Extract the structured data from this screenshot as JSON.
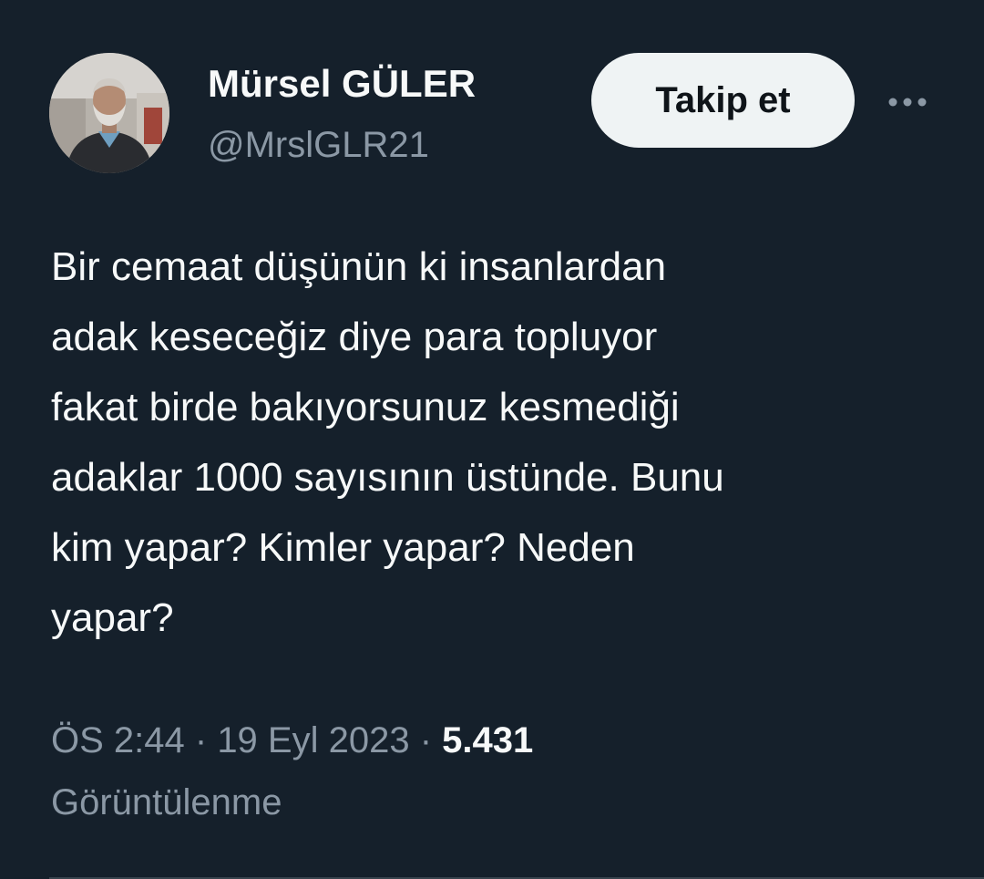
{
  "author": {
    "display_name": "Mürsel GÜLER",
    "handle": "@MrslGLR21",
    "avatar_icon": "profile-photo"
  },
  "actions": {
    "follow_label": "Takip et",
    "more_icon": "more-horizontal-icon"
  },
  "tweet": {
    "text": "Bir cemaat düşünün ki insanlardan\nadak keseceğiz diye para topluyor\nfakat birde bakıyorsunuz kesmediği\nadaklar 1000 sayısının üstünde. Bunu\nkim yapar? Kimler yapar? Neden\nyapar?"
  },
  "meta": {
    "time": "ÖS 2:44",
    "separator": " · ",
    "date": "19 Eyl 2023",
    "views_count": "5.431",
    "views_label": "Görüntülenme"
  },
  "colors": {
    "background": "#15202b",
    "primary_text": "#f7f9f9",
    "secondary_text": "#8b98a5",
    "button_bg": "#eff3f4",
    "button_text": "#0f1419"
  }
}
